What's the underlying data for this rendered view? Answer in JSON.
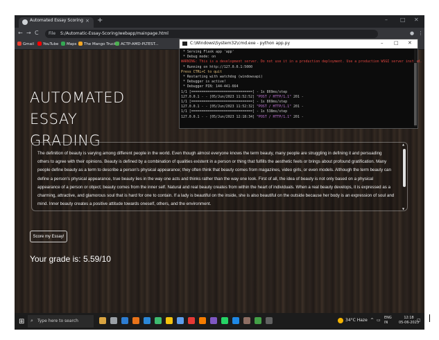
{
  "browser": {
    "tab_title": "Automated Essay Scoring",
    "tab_close": "×",
    "new_tab": "+",
    "url_prefix": "File",
    "url": "S:/Automatic-Essay-Scoring/webapp/mainpage.html",
    "bookmarks": [
      {
        "label": "Gmail",
        "color": "#ea4335"
      },
      {
        "label": "YouTube",
        "color": "#ff0000"
      },
      {
        "label": "Maps",
        "color": "#34a853"
      },
      {
        "label": "The Mango Truck",
        "color": "#f5a623"
      },
      {
        "label": "ACTP-AMD-PLTEST...",
        "color": "#4caf50"
      }
    ]
  },
  "page": {
    "heading_line1": "AUTOMATED ESSAY",
    "heading_line2": "GRADING",
    "essay": "The definition of beauty is varying among different people in the world. Even though almost everyone knows the term beauty, many people are struggling in defining it and persuading others to agree with their opinions. Beauty is defined by a combination of qualities existent in a person or thing that fulfills the aesthetic feels or brings about profound gratification. Many people define beauty as a term to describe a person's physical appearance; they often think that beauty comes from magazines, video girls, or even models. Although the term beauty can define a person's physical appearance, true beauty lies in the way one acts and thinks rather than the way one look. First of all, the idea of beauty is not only based on a physical appearance of a person or object; beauty comes from the inner self. Natural and real beauty creates from within the heart of individuals. When a real beauty develops, it is expressed as a charming, attractive, and glamorous soul that is hard for one to contain. If a lady is beautiful on the inside, she is also beautiful on the outside because her body is an expression of soul and mind. Inner beauty creates a positive attitude towards oneself, others, and the environment.",
    "score_button": "Score my Essay!",
    "grade_text": "Your grade is: 5.59/10"
  },
  "terminal": {
    "title": "C:\\Windows\\System32\\cmd.exe - python  app.py",
    "lines": [
      {
        "text": " * Serving Flask app 'app'",
        "color": "w"
      },
      {
        "text": " * Debug mode: on",
        "color": "w"
      },
      {
        "text": "WARNING: This is a development server. Do not use it in a production deployment. Use a production WSGI server instead.",
        "color": "r"
      },
      {
        "text": " * Running on http://127.0.0.1:5000",
        "color": "w"
      },
      {
        "text": "Press CTRL+C to quit",
        "color": "y"
      },
      {
        "text": " * Restarting with watchdog (windowsapi)",
        "color": "w"
      },
      {
        "text": " * Debugger is active!",
        "color": "w"
      },
      {
        "text": " * Debugger PIN: 144-441-664",
        "color": "w"
      },
      {
        "text": "1/1 [==============================] - 1s 869ms/step",
        "color": "w"
      },
      {
        "text": "127.0.0.1 - - [05/Jun/2023 11:52:52] \"POST / HTTP/1.1\" 201 -",
        "color": "w"
      },
      {
        "text": "1/1 [==============================] - 1s 869ms/step",
        "color": "w"
      },
      {
        "text": "127.0.0.1 - - [05/Jun/2023 11:52:32] \"POST / HTTP/1.1\" 201 -",
        "color": "w"
      },
      {
        "text": "1/1 [==============================] - 1s 538ms/step",
        "color": "w"
      },
      {
        "text": "127.0.0.1 - - [05/Jun/2023 12:18:34] \"POST / HTTP/1.1\" 201 -",
        "color": "w"
      }
    ]
  },
  "taskbar": {
    "search_placeholder": "Type here to search",
    "weather": "34°C  Haze",
    "lang": "ENG",
    "region": "IN",
    "time": "12:18",
    "date": "05-06-2023"
  }
}
